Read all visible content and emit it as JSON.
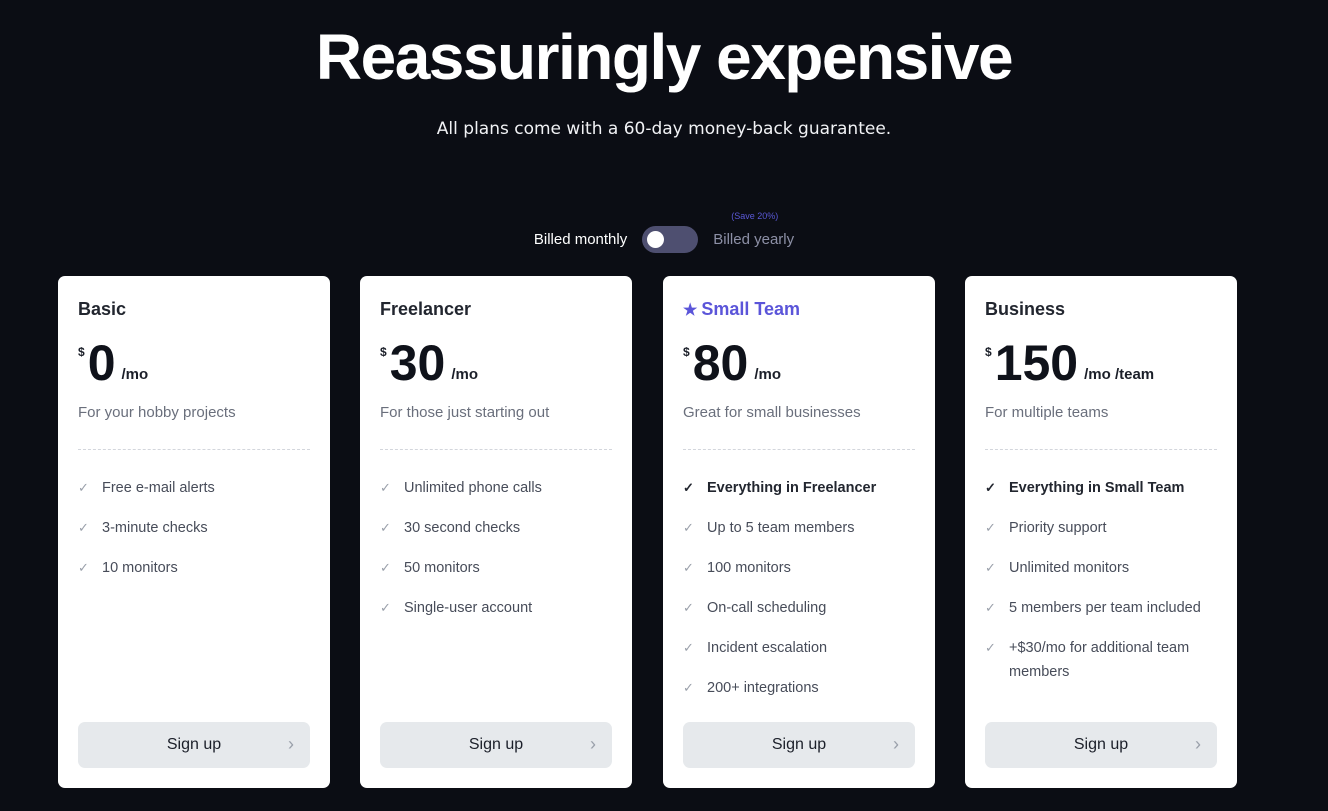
{
  "hero": {
    "title": "Reassuringly expensive",
    "subtitle": "All plans come with a 60-day money-back guarantee."
  },
  "billing": {
    "monthly_label": "Billed monthly",
    "yearly_label": "Billed yearly",
    "save_badge": "(Save 20%)",
    "selected": "monthly"
  },
  "colors": {
    "background": "#0b0d14",
    "accent": "#5b55d9",
    "toggle": "#4e4f70",
    "button": "#e6e9ec"
  },
  "plans": [
    {
      "name": "Basic",
      "featured": false,
      "currency": "$",
      "amount": "0",
      "period": "/mo",
      "description": "For your hobby projects",
      "features": [
        {
          "text": "Free e-mail alerts",
          "strong": false
        },
        {
          "text": "3-minute checks",
          "strong": false
        },
        {
          "text": "10 monitors",
          "strong": false
        }
      ],
      "cta": "Sign up"
    },
    {
      "name": "Freelancer",
      "featured": false,
      "currency": "$",
      "amount": "30",
      "period": "/mo",
      "description": "For those just starting out",
      "features": [
        {
          "text": "Unlimited phone calls",
          "strong": false
        },
        {
          "text": "30 second checks",
          "strong": false
        },
        {
          "text": "50 monitors",
          "strong": false
        },
        {
          "text": "Single-user account",
          "strong": false
        }
      ],
      "cta": "Sign up"
    },
    {
      "name": "Small Team",
      "featured": true,
      "currency": "$",
      "amount": "80",
      "period": "/mo",
      "description": "Great for small businesses",
      "features": [
        {
          "text": "Everything in Freelancer",
          "strong": true
        },
        {
          "text": "Up to 5 team members",
          "strong": false
        },
        {
          "text": "100 monitors",
          "strong": false
        },
        {
          "text": "On-call scheduling",
          "strong": false
        },
        {
          "text": "Incident escalation",
          "strong": false
        },
        {
          "text": "200+ integrations",
          "strong": false
        }
      ],
      "cta": "Sign up"
    },
    {
      "name": "Business",
      "featured": false,
      "currency": "$",
      "amount": "150",
      "period": "/mo /team",
      "description": "For multiple teams",
      "features": [
        {
          "text": "Everything in Small Team",
          "strong": true
        },
        {
          "text": "Priority support",
          "strong": false
        },
        {
          "text": "Unlimited monitors",
          "strong": false
        },
        {
          "text": "5 members per team included",
          "strong": false
        },
        {
          "text": "+$30/mo for additional team members",
          "strong": false
        }
      ],
      "cta": "Sign up"
    }
  ],
  "icons": {
    "check": "✓",
    "star": "★",
    "chevron": "›"
  }
}
